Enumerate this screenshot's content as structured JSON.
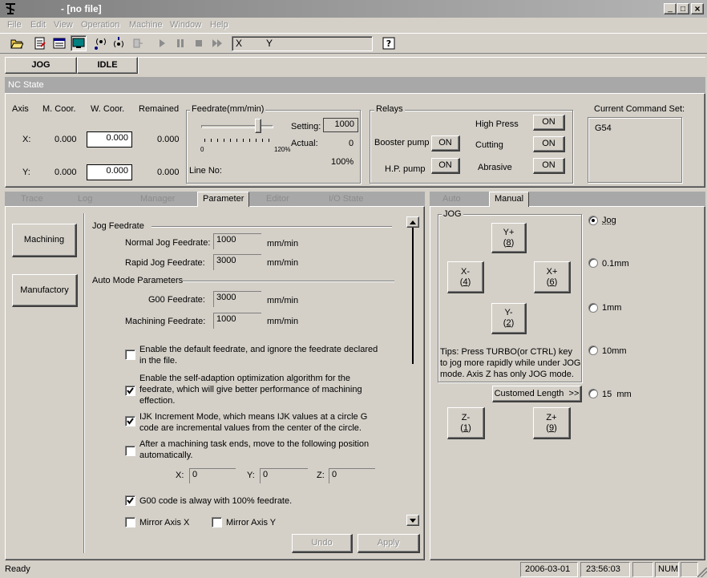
{
  "window": {
    "title": "- [no file]",
    "controls": {
      "minimize": "_",
      "maximize": "□",
      "close": "×"
    }
  },
  "menu": {
    "items": [
      "File",
      "Edit",
      "View",
      "Operation",
      "Machine",
      "Window",
      "Help"
    ]
  },
  "toolbar": {
    "coord_x_label": "X",
    "coord_y_label": "Y"
  },
  "mode_tabs": {
    "jog": "JOG",
    "idle": "IDLE"
  },
  "nc_state": {
    "title": "NC State",
    "axis_header": "Axis",
    "machine_coord_header": "M. Coor.",
    "work_coord_header": "W. Coor.",
    "remained_header": "Remained",
    "x_axis": {
      "label": "X:",
      "machine": "0.000",
      "work": "0.000",
      "remained": "0.000"
    },
    "y_axis": {
      "label": "Y:",
      "machine": "0.000",
      "work": "0.000",
      "remained": "0.000"
    },
    "feedrate": {
      "title": "Feedrate(mm/min)",
      "setting_label": "Setting:",
      "setting_value": "1000",
      "actual_label": "Actual:",
      "actual_value": "0",
      "percent": "100%",
      "slider_min": "0",
      "slider_max": "120%",
      "slider_fraction": 0.83,
      "line_no_label": "Line No:"
    },
    "relays": {
      "title": "Relays",
      "booster_pump_label": "Booster pump",
      "booster_pump_state": "ON",
      "hp_pump_label": "H.P. pump",
      "hp_pump_state": "ON",
      "high_press_label": "High Press",
      "high_press_state": "ON",
      "cutting_label": "Cutting",
      "cutting_state": "ON",
      "abrasive_label": "Abrasive",
      "abrasive_state": "ON"
    },
    "command_set": {
      "title": "Current Command Set:",
      "value": "G54"
    }
  },
  "left_panel": {
    "tabs": [
      "Trace",
      "Log",
      "Manager",
      "Parameter",
      "Editor",
      "I/O State"
    ],
    "active_tab": "Parameter",
    "side_buttons": {
      "machining": "Machining",
      "manufactory": "Manufactory"
    },
    "jog_feedrate": {
      "section_title": "Jog Feedrate",
      "normal_label": "Normal Jog Feedrate:",
      "normal_value": "1000",
      "rapid_label": "Rapid Jog Feedrate:",
      "rapid_value": "3000",
      "unit": "mm/min"
    },
    "auto_mode": {
      "section_title": "Auto Mode Parameters",
      "g00_label": "G00 Feedrate:",
      "g00_value": "3000",
      "machining_label": "Machining Feedrate:",
      "machining_value": "1000",
      "unit": "mm/min"
    },
    "options": {
      "default_feedrate": {
        "text": "Enable the default feedrate, and ignore the feedrate declared in the file.",
        "checked": false
      },
      "self_adaption": {
        "text": "Enable the self-adaption optimization algorithm for the feedrate, which will give better performance of machining effection.",
        "checked": true
      },
      "ijk_mode": {
        "text": "IJK Increment Mode, which means IJK values at a circle G code are incremental values from the center of the circle.",
        "checked": true
      },
      "move_after": {
        "text": "After a machining task ends, move to the following position automatically.",
        "checked": false
      },
      "g00_full": {
        "text": "G00 code is alway with 100% feedrate.",
        "checked": true
      },
      "mirror_x": {
        "text": "Mirror Axis X",
        "checked": false
      },
      "mirror_y": {
        "text": "Mirror Axis Y",
        "checked": false
      }
    },
    "position": {
      "x_label": "X:",
      "x_value": "0",
      "y_label": "Y:",
      "y_value": "0",
      "z_label": "Z:",
      "z_value": "0"
    },
    "undo_label": "Undo",
    "apply_label": "Apply"
  },
  "right_panel": {
    "tabs": [
      "Auto",
      "Manual"
    ],
    "active_tab": "Manual",
    "jog_group_title": "JOG",
    "buttons": {
      "y_plus": {
        "label": "Y+",
        "key": "8"
      },
      "y_minus": {
        "label": "Y-",
        "key": "2"
      },
      "x_minus": {
        "label": "X-",
        "key": "4"
      },
      "x_plus": {
        "label": "X+",
        "key": "6"
      },
      "z_minus": {
        "label": "Z-",
        "key": "1"
      },
      "z_plus": {
        "label": "Z+",
        "key": "9"
      }
    },
    "tips": "Tips: Press TURBO(or CTRL) key to jog more rapidly while under JOG mode. Axis Z has only JOG mode.",
    "custom_length_label": "Customed Length  >>",
    "step_options": [
      {
        "label": "Jog",
        "selected": true
      },
      {
        "label": "0.1mm",
        "selected": false
      },
      {
        "label": "1mm",
        "selected": false
      },
      {
        "label": "10mm",
        "selected": false
      },
      {
        "label": "15  mm",
        "selected": false
      }
    ]
  },
  "status_bar": {
    "status": "Ready",
    "date": "2006-03-01",
    "time": "23:56:03",
    "num": "NUM"
  }
}
